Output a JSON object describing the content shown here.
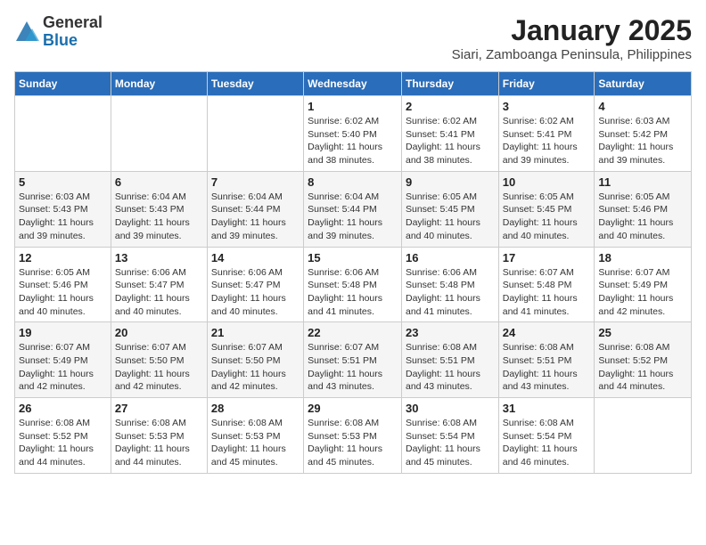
{
  "header": {
    "logo_general": "General",
    "logo_blue": "Blue",
    "month_title": "January 2025",
    "subtitle": "Siari, Zamboanga Peninsula, Philippines"
  },
  "weekdays": [
    "Sunday",
    "Monday",
    "Tuesday",
    "Wednesday",
    "Thursday",
    "Friday",
    "Saturday"
  ],
  "weeks": [
    [
      {
        "num": "",
        "sunrise": "",
        "sunset": "",
        "daylight": ""
      },
      {
        "num": "",
        "sunrise": "",
        "sunset": "",
        "daylight": ""
      },
      {
        "num": "",
        "sunrise": "",
        "sunset": "",
        "daylight": ""
      },
      {
        "num": "1",
        "sunrise": "Sunrise: 6:02 AM",
        "sunset": "Sunset: 5:40 PM",
        "daylight": "Daylight: 11 hours and 38 minutes."
      },
      {
        "num": "2",
        "sunrise": "Sunrise: 6:02 AM",
        "sunset": "Sunset: 5:41 PM",
        "daylight": "Daylight: 11 hours and 38 minutes."
      },
      {
        "num": "3",
        "sunrise": "Sunrise: 6:02 AM",
        "sunset": "Sunset: 5:41 PM",
        "daylight": "Daylight: 11 hours and 39 minutes."
      },
      {
        "num": "4",
        "sunrise": "Sunrise: 6:03 AM",
        "sunset": "Sunset: 5:42 PM",
        "daylight": "Daylight: 11 hours and 39 minutes."
      }
    ],
    [
      {
        "num": "5",
        "sunrise": "Sunrise: 6:03 AM",
        "sunset": "Sunset: 5:43 PM",
        "daylight": "Daylight: 11 hours and 39 minutes."
      },
      {
        "num": "6",
        "sunrise": "Sunrise: 6:04 AM",
        "sunset": "Sunset: 5:43 PM",
        "daylight": "Daylight: 11 hours and 39 minutes."
      },
      {
        "num": "7",
        "sunrise": "Sunrise: 6:04 AM",
        "sunset": "Sunset: 5:44 PM",
        "daylight": "Daylight: 11 hours and 39 minutes."
      },
      {
        "num": "8",
        "sunrise": "Sunrise: 6:04 AM",
        "sunset": "Sunset: 5:44 PM",
        "daylight": "Daylight: 11 hours and 39 minutes."
      },
      {
        "num": "9",
        "sunrise": "Sunrise: 6:05 AM",
        "sunset": "Sunset: 5:45 PM",
        "daylight": "Daylight: 11 hours and 40 minutes."
      },
      {
        "num": "10",
        "sunrise": "Sunrise: 6:05 AM",
        "sunset": "Sunset: 5:45 PM",
        "daylight": "Daylight: 11 hours and 40 minutes."
      },
      {
        "num": "11",
        "sunrise": "Sunrise: 6:05 AM",
        "sunset": "Sunset: 5:46 PM",
        "daylight": "Daylight: 11 hours and 40 minutes."
      }
    ],
    [
      {
        "num": "12",
        "sunrise": "Sunrise: 6:05 AM",
        "sunset": "Sunset: 5:46 PM",
        "daylight": "Daylight: 11 hours and 40 minutes."
      },
      {
        "num": "13",
        "sunrise": "Sunrise: 6:06 AM",
        "sunset": "Sunset: 5:47 PM",
        "daylight": "Daylight: 11 hours and 40 minutes."
      },
      {
        "num": "14",
        "sunrise": "Sunrise: 6:06 AM",
        "sunset": "Sunset: 5:47 PM",
        "daylight": "Daylight: 11 hours and 40 minutes."
      },
      {
        "num": "15",
        "sunrise": "Sunrise: 6:06 AM",
        "sunset": "Sunset: 5:48 PM",
        "daylight": "Daylight: 11 hours and 41 minutes."
      },
      {
        "num": "16",
        "sunrise": "Sunrise: 6:06 AM",
        "sunset": "Sunset: 5:48 PM",
        "daylight": "Daylight: 11 hours and 41 minutes."
      },
      {
        "num": "17",
        "sunrise": "Sunrise: 6:07 AM",
        "sunset": "Sunset: 5:48 PM",
        "daylight": "Daylight: 11 hours and 41 minutes."
      },
      {
        "num": "18",
        "sunrise": "Sunrise: 6:07 AM",
        "sunset": "Sunset: 5:49 PM",
        "daylight": "Daylight: 11 hours and 42 minutes."
      }
    ],
    [
      {
        "num": "19",
        "sunrise": "Sunrise: 6:07 AM",
        "sunset": "Sunset: 5:49 PM",
        "daylight": "Daylight: 11 hours and 42 minutes."
      },
      {
        "num": "20",
        "sunrise": "Sunrise: 6:07 AM",
        "sunset": "Sunset: 5:50 PM",
        "daylight": "Daylight: 11 hours and 42 minutes."
      },
      {
        "num": "21",
        "sunrise": "Sunrise: 6:07 AM",
        "sunset": "Sunset: 5:50 PM",
        "daylight": "Daylight: 11 hours and 42 minutes."
      },
      {
        "num": "22",
        "sunrise": "Sunrise: 6:07 AM",
        "sunset": "Sunset: 5:51 PM",
        "daylight": "Daylight: 11 hours and 43 minutes."
      },
      {
        "num": "23",
        "sunrise": "Sunrise: 6:08 AM",
        "sunset": "Sunset: 5:51 PM",
        "daylight": "Daylight: 11 hours and 43 minutes."
      },
      {
        "num": "24",
        "sunrise": "Sunrise: 6:08 AM",
        "sunset": "Sunset: 5:51 PM",
        "daylight": "Daylight: 11 hours and 43 minutes."
      },
      {
        "num": "25",
        "sunrise": "Sunrise: 6:08 AM",
        "sunset": "Sunset: 5:52 PM",
        "daylight": "Daylight: 11 hours and 44 minutes."
      }
    ],
    [
      {
        "num": "26",
        "sunrise": "Sunrise: 6:08 AM",
        "sunset": "Sunset: 5:52 PM",
        "daylight": "Daylight: 11 hours and 44 minutes."
      },
      {
        "num": "27",
        "sunrise": "Sunrise: 6:08 AM",
        "sunset": "Sunset: 5:53 PM",
        "daylight": "Daylight: 11 hours and 44 minutes."
      },
      {
        "num": "28",
        "sunrise": "Sunrise: 6:08 AM",
        "sunset": "Sunset: 5:53 PM",
        "daylight": "Daylight: 11 hours and 45 minutes."
      },
      {
        "num": "29",
        "sunrise": "Sunrise: 6:08 AM",
        "sunset": "Sunset: 5:53 PM",
        "daylight": "Daylight: 11 hours and 45 minutes."
      },
      {
        "num": "30",
        "sunrise": "Sunrise: 6:08 AM",
        "sunset": "Sunset: 5:54 PM",
        "daylight": "Daylight: 11 hours and 45 minutes."
      },
      {
        "num": "31",
        "sunrise": "Sunrise: 6:08 AM",
        "sunset": "Sunset: 5:54 PM",
        "daylight": "Daylight: 11 hours and 46 minutes."
      },
      {
        "num": "",
        "sunrise": "",
        "sunset": "",
        "daylight": ""
      }
    ]
  ]
}
